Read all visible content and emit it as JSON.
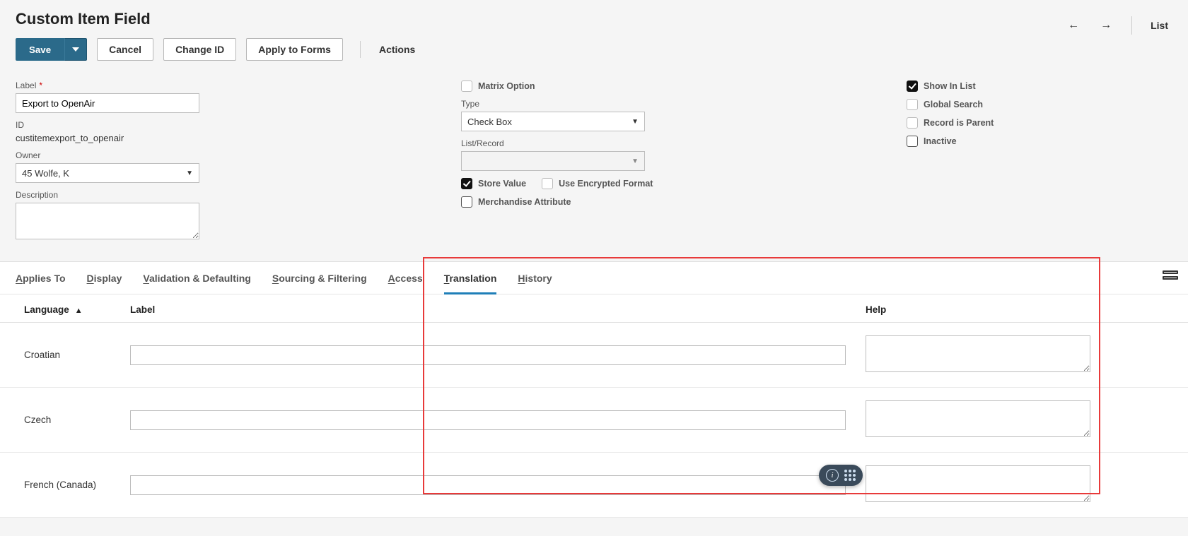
{
  "header": {
    "title": "Custom Item Field",
    "back_arrow": "←",
    "fwd_arrow": "→",
    "list_link": "List"
  },
  "toolbar": {
    "save_label": "Save",
    "cancel_label": "Cancel",
    "change_id_label": "Change ID",
    "apply_forms_label": "Apply to Forms",
    "actions_label": "Actions"
  },
  "form": {
    "label_label": "Label",
    "label_value": "Export to OpenAir",
    "id_label": "ID",
    "id_value": "custitemexport_to_openair",
    "owner_label": "Owner",
    "owner_value": "45 Wolfe, K",
    "description_label": "Description",
    "description_value": "",
    "matrix_option_label": "Matrix Option",
    "type_label": "Type",
    "type_value": "Check Box",
    "list_record_label": "List/Record",
    "list_record_value": "",
    "store_value_label": "Store Value",
    "use_encrypted_label": "Use Encrypted Format",
    "merchandise_attr_label": "Merchandise Attribute",
    "show_in_list_label": "Show In List",
    "global_search_label": "Global Search",
    "record_is_parent_label": "Record is Parent",
    "inactive_label": "Inactive"
  },
  "checkboxes": {
    "matrix_option": false,
    "store_value": true,
    "use_encrypted": false,
    "merchandise_attr": false,
    "show_in_list": true,
    "global_search": false,
    "record_is_parent": false,
    "inactive": false
  },
  "tabs": {
    "applies_to": {
      "pre": "A",
      "rest": "pplies To"
    },
    "display": {
      "pre": "D",
      "rest": "isplay"
    },
    "validation": {
      "pre": "V",
      "rest": "alidation & Defaulting"
    },
    "sourcing": {
      "pre": "S",
      "rest": "ourcing & Filtering"
    },
    "access": {
      "pre": "A",
      "rest": "ccess"
    },
    "translation": {
      "pre": "T",
      "rest": "ranslation"
    },
    "history": {
      "pre": "H",
      "rest": "istory"
    },
    "active": "translation"
  },
  "table": {
    "col_language": "Language",
    "col_label": "Label",
    "col_help": "Help",
    "rows": [
      {
        "language": "Croatian",
        "label": "",
        "help": ""
      },
      {
        "language": "Czech",
        "label": "",
        "help": ""
      },
      {
        "language": "French (Canada)",
        "label": "",
        "help": ""
      }
    ]
  }
}
